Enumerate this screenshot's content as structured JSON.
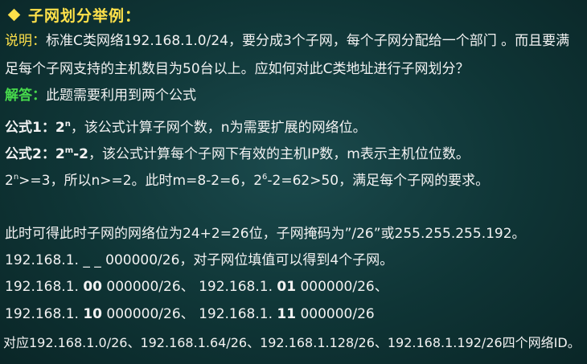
{
  "heading": {
    "title": "子网划分举例："
  },
  "description": {
    "label": "说明：",
    "text1": "标准C类网络192.168.1.0/24，要分成3个子网，每个子网分配给一个部门 。而且要满",
    "text2": "足每个子网支持的主机数目为50台以上。应如何对此C类地址进行子网划分？"
  },
  "answer": {
    "label": "解答：",
    "text": "此题需要利用到两个公式"
  },
  "formula1": {
    "label": "公式1：",
    "base": "2",
    "exp": "n",
    "text": "，该公式计算子网个数，n为需要扩展的网络位。"
  },
  "formula2": {
    "label": "公式2：",
    "base": "2",
    "exp": "m",
    "tail": "-2",
    "text": "，该公式计算每个子网下有效的主机IP数，m表示主机位位数。"
  },
  "calc": {
    "base1": "2",
    "exp1": "n",
    "part1": ">=3，所以n>=2。此时m=8-2=6，",
    "base2": "2",
    "exp2": "6",
    "part2": "-2=62>50，满足每个子网的要求。"
  },
  "mask_line": "此时可得此时子网的网络位为24+2=26位，子网掩码为”/26”或255.255.255.192。",
  "fill_line": "192.168.1. _ _ 000000/26，对子网位填值可以得到4个子网。",
  "subnets_row1": {
    "a_prefix": "192.168.1. ",
    "a_bits": "00",
    "a_suffix": " 000000/26、 ",
    "b_prefix": "192.168.1. ",
    "b_bits": "01",
    "b_suffix": " 000000/26、"
  },
  "subnets_row2": {
    "a_prefix": "192.168.1. ",
    "a_bits": "10",
    "a_suffix": " 000000/26、 ",
    "b_prefix": "192.168.1. ",
    "b_bits": "11",
    "b_suffix": " 000000/26"
  },
  "network_ids": "对应192.168.1.0/26、192.168.1.64/26、192.168.1.128/26、192.168.1.192/26四个网络ID。",
  "colors": {
    "background": "#0f3536",
    "heading": "#ffe14a",
    "label_yellow": "#ffe14a",
    "label_green": "#47d94c",
    "text": "#f2f2f2"
  },
  "icons": {
    "bullet": "diamond-bullet-icon"
  }
}
